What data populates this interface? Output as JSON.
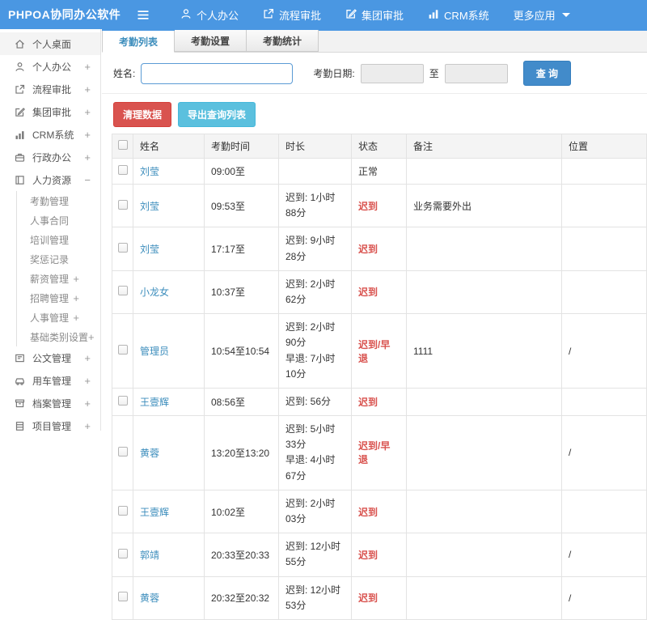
{
  "colors": {
    "topbar": "#4a97e2",
    "link": "#3c8dbc",
    "late": "#d9534f",
    "danger": "#d9534f",
    "info": "#5bc0de",
    "primary": "#428bca"
  },
  "topbar": {
    "logo": "PHPOA协同办公软件",
    "nav": [
      {
        "label": "个人办公",
        "icon": "user-icon"
      },
      {
        "label": "流程审批",
        "icon": "workflow-icon"
      },
      {
        "label": "集团审批",
        "icon": "edit-icon"
      },
      {
        "label": "CRM系统",
        "icon": "chart-icon"
      },
      {
        "label": "更多应用",
        "icon": null,
        "caret": true
      }
    ]
  },
  "sidebar": {
    "items": [
      {
        "label": "个人桌面",
        "icon": "home-icon",
        "expand": "",
        "active": true
      },
      {
        "label": "个人办公",
        "icon": "user-icon",
        "expand": "+"
      },
      {
        "label": "流程审批",
        "icon": "workflow-icon",
        "expand": "+"
      },
      {
        "label": "集团审批",
        "icon": "edit-icon",
        "expand": "+"
      },
      {
        "label": "CRM系统",
        "icon": "chart-icon",
        "expand": "+"
      },
      {
        "label": "行政办公",
        "icon": "briefcase-icon",
        "expand": "+"
      },
      {
        "label": "人力资源",
        "icon": "book-icon",
        "expand": "−",
        "children": [
          {
            "label": "考勤管理",
            "expand": ""
          },
          {
            "label": "人事合同",
            "expand": ""
          },
          {
            "label": "培训管理",
            "expand": ""
          },
          {
            "label": "奖惩记录",
            "expand": ""
          },
          {
            "label": "薪资管理",
            "expand": "+"
          },
          {
            "label": "招聘管理",
            "expand": "+"
          },
          {
            "label": "人事管理",
            "expand": "+"
          },
          {
            "label": "基础类别设置",
            "expand": "+"
          }
        ]
      },
      {
        "label": "公文管理",
        "icon": "doc-icon",
        "expand": "+"
      },
      {
        "label": "用车管理",
        "icon": "car-icon",
        "expand": "+"
      },
      {
        "label": "档案管理",
        "icon": "archive-icon",
        "expand": "+"
      },
      {
        "label": "项目管理",
        "icon": "project-icon",
        "expand": "+"
      }
    ]
  },
  "tabs": [
    {
      "label": "考勤列表",
      "active": true
    },
    {
      "label": "考勤设置",
      "active": false
    },
    {
      "label": "考勤统计",
      "active": false
    }
  ],
  "filter": {
    "name_label": "姓名:",
    "name_value": "",
    "date_label": "考勤日期:",
    "date_from": "",
    "date_to": "",
    "to_label": "至",
    "query_button": "查 询"
  },
  "actions": {
    "clear_button": "清理数据",
    "export_button": "导出查询列表"
  },
  "table": {
    "columns": [
      "姓名",
      "考勤时间",
      "时长",
      "状态",
      "备注",
      "位置"
    ],
    "rows": [
      {
        "name": "刘莹",
        "time": "09:00至",
        "duration": [],
        "status": "正常",
        "status_type": "normal",
        "note": "",
        "location": ""
      },
      {
        "name": "刘莹",
        "time": "09:53至",
        "duration": [
          "迟到: 1小时88分"
        ],
        "status": "迟到",
        "status_type": "late",
        "note": "业务需要外出",
        "location": ""
      },
      {
        "name": "刘莹",
        "time": "17:17至",
        "duration": [
          "迟到: 9小时28分"
        ],
        "status": "迟到",
        "status_type": "late",
        "note": "",
        "location": ""
      },
      {
        "name": "小龙女",
        "time": "10:37至",
        "duration": [
          "迟到: 2小时62分"
        ],
        "status": "迟到",
        "status_type": "late",
        "note": "",
        "location": ""
      },
      {
        "name": "管理员",
        "time": "10:54至10:54",
        "duration": [
          "迟到: 2小时90分",
          "早退: 7小时10分"
        ],
        "status": "迟到/早退",
        "status_type": "late",
        "note": "1111",
        "location": "/"
      },
      {
        "name": "王壹辉",
        "time": "08:56至",
        "duration": [
          "迟到: 56分"
        ],
        "status": "迟到",
        "status_type": "late",
        "note": "",
        "location": ""
      },
      {
        "name": "黄蓉",
        "time": "13:20至13:20",
        "duration": [
          "迟到: 5小时33分",
          "早退: 4小时67分"
        ],
        "status": "迟到/早退",
        "status_type": "late",
        "note": "",
        "location": "/"
      },
      {
        "name": "王壹辉",
        "time": "10:02至",
        "duration": [
          "迟到: 2小时03分"
        ],
        "status": "迟到",
        "status_type": "late",
        "note": "",
        "location": ""
      },
      {
        "name": "郭靖",
        "time": "20:33至20:33",
        "duration": [
          "迟到: 12小时55分"
        ],
        "status": "迟到",
        "status_type": "late",
        "note": "",
        "location": "/"
      },
      {
        "name": "黄蓉",
        "time": "20:32至20:32",
        "duration": [
          "迟到: 12小时53分"
        ],
        "status": "迟到",
        "status_type": "late",
        "note": "",
        "location": "/"
      }
    ]
  }
}
